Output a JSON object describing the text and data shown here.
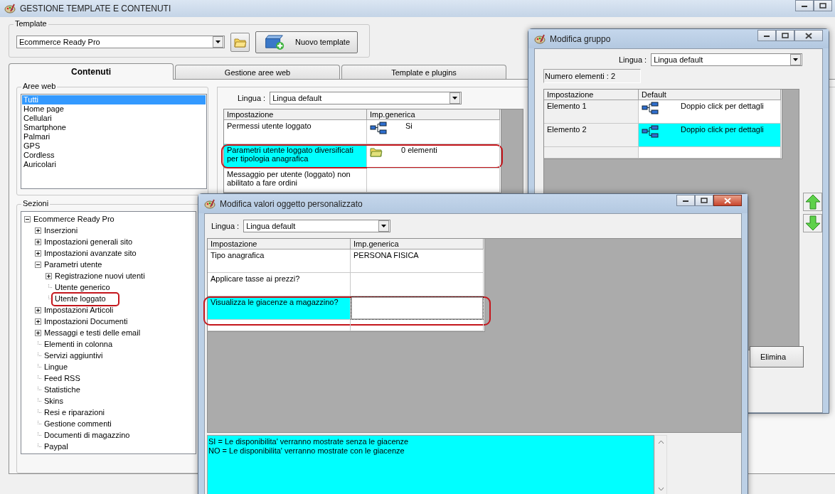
{
  "window": {
    "title": "GESTIONE TEMPLATE E CONTENUTI"
  },
  "template": {
    "label": "Template",
    "value": "Ecommerce Ready Pro",
    "new_button": "Nuovo template"
  },
  "tabs": [
    {
      "label": "Contenuti",
      "selected": true
    },
    {
      "label": "Gestione aree web",
      "selected": false
    },
    {
      "label": "Template e plugins",
      "selected": false
    }
  ],
  "aree_web": {
    "label": "Aree web",
    "items": [
      {
        "label": "Tutti",
        "selected": true
      },
      {
        "label": "Home page",
        "selected": false
      },
      {
        "label": "Cellulari",
        "selected": false
      },
      {
        "label": "Smartphone",
        "selected": false
      },
      {
        "label": "Palmari",
        "selected": false
      },
      {
        "label": "GPS",
        "selected": false
      },
      {
        "label": "Cordless",
        "selected": false
      },
      {
        "label": "Auricolari",
        "selected": false
      }
    ]
  },
  "sezioni": {
    "label": "Sezioni",
    "tree": [
      {
        "label": "Ecommerce Ready Pro",
        "kind": "branch",
        "expanded": true,
        "children": [
          {
            "label": "Inserzioni",
            "kind": "branch",
            "expanded": false
          },
          {
            "label": "Impostazioni generali sito",
            "kind": "branch",
            "expanded": false
          },
          {
            "label": "Impostazioni avanzate sito",
            "kind": "branch",
            "expanded": false
          },
          {
            "label": "Parametri utente",
            "kind": "branch",
            "expanded": true,
            "children": [
              {
                "label": "Registrazione nuovi utenti",
                "kind": "branch",
                "expanded": false
              },
              {
                "label": "Utente generico",
                "kind": "leaf"
              },
              {
                "label": "Utente loggato",
                "kind": "leaf",
                "circled": true
              }
            ]
          },
          {
            "label": "Impostazioni Articoli",
            "kind": "branch",
            "expanded": false
          },
          {
            "label": "Impostazioni Documenti",
            "kind": "branch",
            "expanded": false
          },
          {
            "label": "Messaggi e testi delle email",
            "kind": "branch",
            "expanded": false
          },
          {
            "label": "Elementi in colonna",
            "kind": "leaf"
          },
          {
            "label": "Servizi aggiuntivi",
            "kind": "leaf"
          },
          {
            "label": "Lingue",
            "kind": "leaf"
          },
          {
            "label": "Feed RSS",
            "kind": "leaf"
          },
          {
            "label": "Statistiche",
            "kind": "leaf"
          },
          {
            "label": "Skins",
            "kind": "leaf"
          },
          {
            "label": "Resi e riparazioni",
            "kind": "leaf"
          },
          {
            "label": "Gestione commenti",
            "kind": "leaf"
          },
          {
            "label": "Documenti di magazzino",
            "kind": "leaf"
          },
          {
            "label": "Paypal",
            "kind": "leaf"
          }
        ]
      }
    ]
  },
  "settings": {
    "lingua_label": "Lingua :",
    "lingua": "Lingua default",
    "columns": [
      "Impostazione",
      "Imp.generica"
    ],
    "rows": [
      {
        "name": "Permessi utente loggato",
        "kind": "tree",
        "value": "Si",
        "selected": false
      },
      {
        "name": "Parametri utente loggato diversificati per tipologia anagrafica",
        "kind": "folder",
        "value": "0 elementi",
        "selected": true,
        "circled": true
      },
      {
        "name": "Messaggio per utente (loggato) non abilitato a fare ordini",
        "kind": "text",
        "selected": false
      }
    ]
  },
  "group_dialog": {
    "title": "Modifica gruppo",
    "lingua_label": "Lingua :",
    "lingua": "Lingua default",
    "count": "Numero elementi : 2",
    "columns": [
      "Impostazione",
      "Default"
    ],
    "rows": [
      {
        "name": "Elemento 1",
        "value": "Doppio click per dettagli",
        "selected": false
      },
      {
        "name": "Elemento 2",
        "value": "Doppio click per dettagli",
        "selected": true
      }
    ],
    "delete_button": "Elimina"
  },
  "values_dialog": {
    "title": "Modifica valori oggetto personalizzato",
    "lingua_label": "Lingua :",
    "lingua": "Lingua default",
    "columns": [
      "Impostazione",
      "Imp.generica"
    ],
    "rows": [
      {
        "name": "Tipo anagrafica",
        "value": "PERSONA FISICA",
        "selected": false
      },
      {
        "name": "Applicare tasse ai prezzi?",
        "selected": false
      },
      {
        "name": "Visualizza le giacenze a magazzino?",
        "selected": true,
        "circled": true
      }
    ],
    "help_lines": [
      "SI = Le disponibilita' verranno mostrate senza le giacenze",
      "NO = Le disponibilita' verranno mostrate con le giacenze"
    ]
  }
}
